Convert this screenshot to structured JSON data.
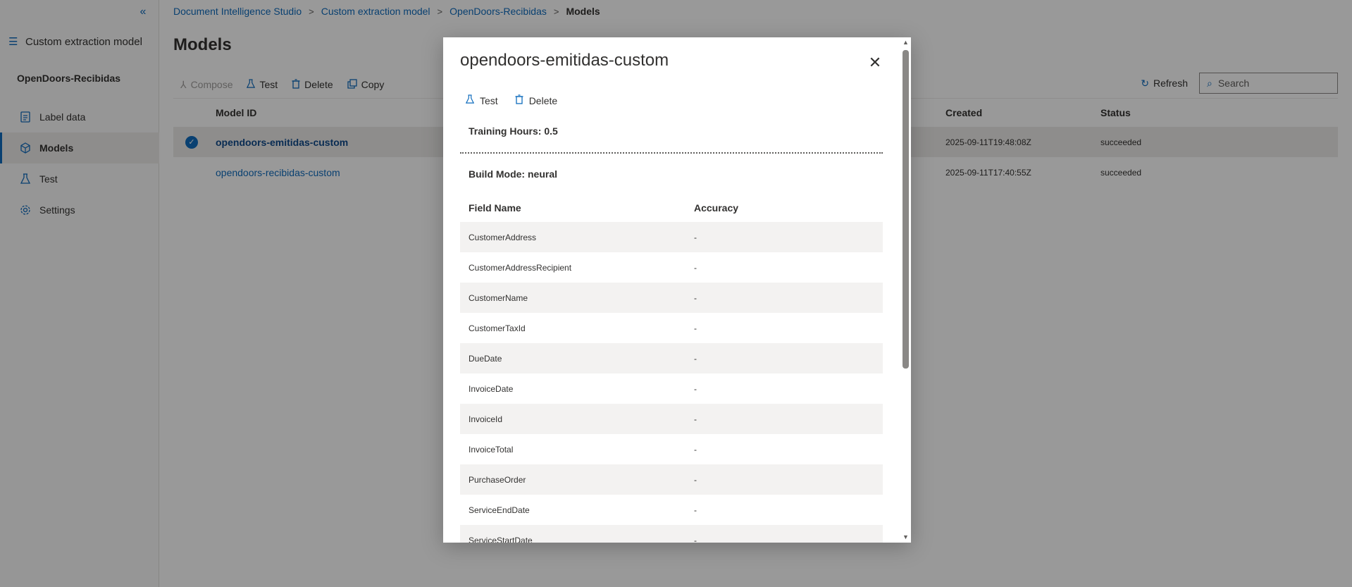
{
  "breadcrumb": {
    "items": [
      "Document Intelligence Studio",
      "Custom extraction model",
      "OpenDoors-Recibidas"
    ],
    "current": "Models",
    "separator": ">"
  },
  "sidebar": {
    "collapse_icon": "«",
    "project_label": "Custom extraction model",
    "project_name": "OpenDoors-Recibidas",
    "items": [
      {
        "label": "Label data",
        "icon": "document-icon"
      },
      {
        "label": "Models",
        "icon": "cube-icon",
        "active": true
      },
      {
        "label": "Test",
        "icon": "beaker-icon"
      },
      {
        "label": "Settings",
        "icon": "gear-icon"
      }
    ]
  },
  "page": {
    "title": "Models"
  },
  "toolbar": {
    "compose_label": "Compose",
    "test_label": "Test",
    "delete_label": "Delete",
    "copy_label": "Copy",
    "refresh_label": "Refresh",
    "search_placeholder": "Search"
  },
  "table": {
    "headers": {
      "model_id": "Model ID",
      "created": "Created",
      "status": "Status"
    },
    "rows": [
      {
        "model_id": "opendoors-emitidas-custom",
        "created": "2025-09-11T19:48:08Z",
        "status": "succeeded",
        "selected": true
      },
      {
        "model_id": "opendoors-recibidas-custom",
        "created": "2025-09-11T17:40:55Z",
        "status": "succeeded",
        "selected": false
      }
    ]
  },
  "modal": {
    "title": "opendoors-emitidas-custom",
    "close_icon": "✕",
    "test_label": "Test",
    "delete_label": "Delete",
    "training_hours": "Training Hours: 0.5",
    "build_mode": "Build Mode: neural",
    "field_header": "Field Name",
    "accuracy_header": "Accuracy",
    "fields": [
      {
        "name": "CustomerAddress",
        "accuracy": "-"
      },
      {
        "name": "CustomerAddressRecipient",
        "accuracy": "-"
      },
      {
        "name": "CustomerName",
        "accuracy": "-"
      },
      {
        "name": "CustomerTaxId",
        "accuracy": "-"
      },
      {
        "name": "DueDate",
        "accuracy": "-"
      },
      {
        "name": "InvoiceDate",
        "accuracy": "-"
      },
      {
        "name": "InvoiceId",
        "accuracy": "-"
      },
      {
        "name": "InvoiceTotal",
        "accuracy": "-"
      },
      {
        "name": "PurchaseOrder",
        "accuracy": "-"
      },
      {
        "name": "ServiceEndDate",
        "accuracy": "-"
      },
      {
        "name": "ServiceStartDate",
        "accuracy": "-"
      }
    ]
  },
  "colors": {
    "accent": "#0f6cbd",
    "overlay": "rgba(0,0,0,0.4)",
    "row_alt": "#f3f2f1"
  }
}
